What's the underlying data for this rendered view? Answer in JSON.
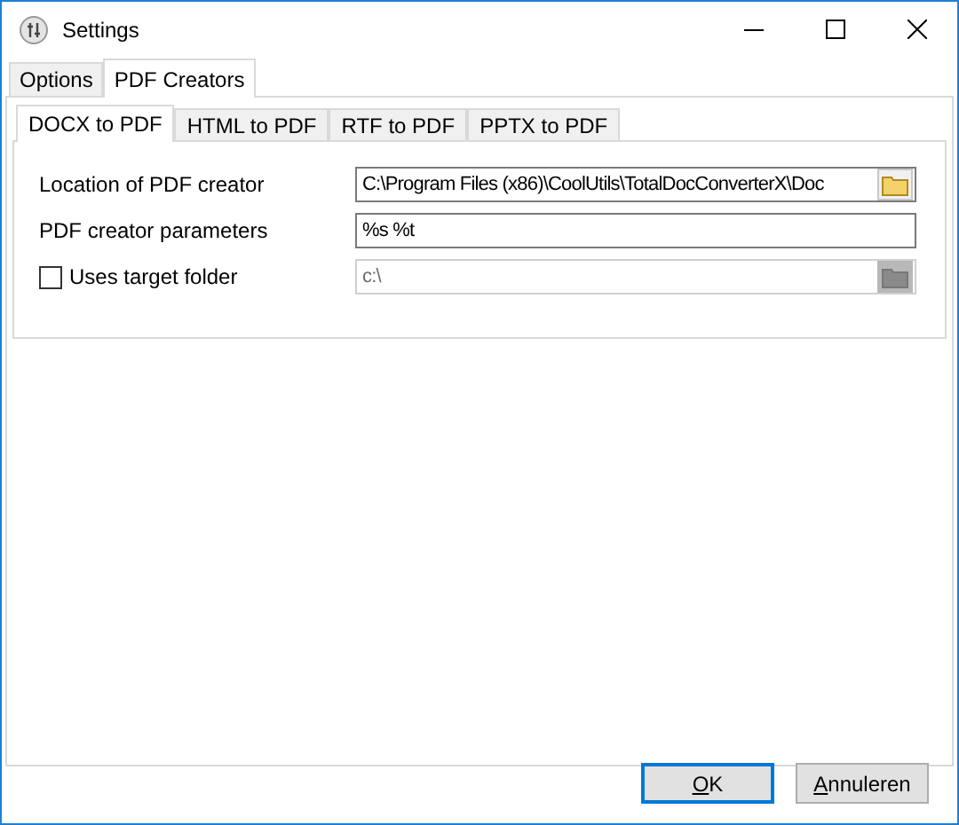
{
  "window": {
    "title": "Settings"
  },
  "tabs": [
    {
      "label": "Options",
      "selected": false
    },
    {
      "label": "PDF Creators",
      "selected": true
    }
  ],
  "subtabs": [
    {
      "label": "DOCX to PDF",
      "selected": true
    },
    {
      "label": "HTML to PDF",
      "selected": false
    },
    {
      "label": "RTF to PDF",
      "selected": false
    },
    {
      "label": "PPTX to PDF",
      "selected": false
    }
  ],
  "fields": [
    {
      "kind": "path",
      "label": "Location of PDF creator",
      "value": "C:\\Program Files (x86)\\CoolUtils\\TotalDocConverterX\\Doc",
      "disabled": false
    },
    {
      "kind": "text",
      "label": "PDF creator parameters",
      "value": "%s %t",
      "disabled": false
    },
    {
      "kind": "checkpath",
      "label": "Uses target folder",
      "checked": false,
      "value": "c:\\",
      "disabled": true
    }
  ],
  "buttons": [
    {
      "label": "OK",
      "default": true
    },
    {
      "label": "Annuleren",
      "default": false
    }
  ]
}
